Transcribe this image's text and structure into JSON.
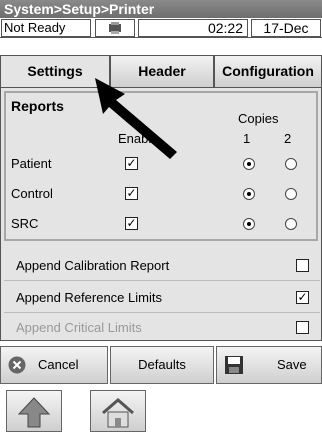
{
  "window": {
    "breadcrumb": "System>Setup>Printer"
  },
  "status": {
    "state": "Not Ready",
    "time": "02:22",
    "date": "17-Dec",
    "icon": "printer-status-icon"
  },
  "tabs": [
    {
      "label": "Settings",
      "active": true
    },
    {
      "label": "Header",
      "active": false
    },
    {
      "label": "Configuration",
      "active": false
    }
  ],
  "reports": {
    "title": "Reports",
    "copies_label": "Copies",
    "enable_label": "Enable",
    "copy_options": [
      "1",
      "2"
    ],
    "rows": [
      {
        "label": "Patient",
        "enabled": true,
        "copies": "1"
      },
      {
        "label": "Control",
        "enabled": true,
        "copies": "1"
      },
      {
        "label": "SRC",
        "enabled": true,
        "copies": "1"
      }
    ]
  },
  "options": [
    {
      "label": "Append Calibration Report",
      "checked": false,
      "disabled": false
    },
    {
      "label": "Append Reference Limits",
      "checked": true,
      "disabled": false
    },
    {
      "label": "Append Critical Limits",
      "checked": false,
      "disabled": true
    }
  ],
  "buttons": {
    "cancel": "Cancel",
    "defaults": "Defaults",
    "save": "Save"
  },
  "nav": {
    "up_icon": "up-arrow-icon",
    "home_icon": "home-icon"
  },
  "colors": {
    "panel": "#e4e4e4",
    "titlebar": "#7a7a7a",
    "disabled_text": "#999999"
  }
}
